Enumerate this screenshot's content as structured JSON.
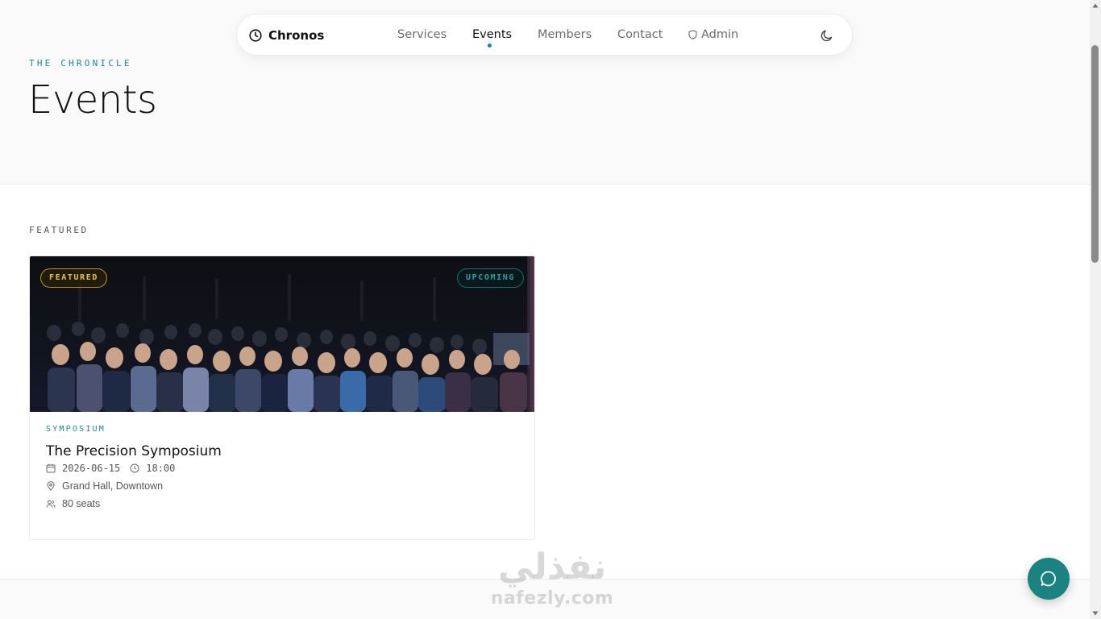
{
  "navbar": {
    "brand": "Chronos",
    "items": [
      {
        "label": "Services",
        "active": false
      },
      {
        "label": "Events",
        "active": true
      },
      {
        "label": "Members",
        "active": false
      },
      {
        "label": "Contact",
        "active": false
      }
    ],
    "admin_label": "Admin",
    "theme_icon": "moon-icon"
  },
  "hero": {
    "eyebrow": "THE CHRONICLE",
    "title": "Events"
  },
  "featured_section": {
    "label": "FEATURED",
    "card": {
      "badge_left": "FEATURED",
      "badge_right": "UPCOMING",
      "category": "SYMPOSIUM",
      "title": "The Precision Symposium",
      "date": "2026-06-15",
      "time": "18:00",
      "location": "Grand Hall, Downtown",
      "seats": "80 seats",
      "image_alt": "audience seated in a dark auditorium"
    }
  },
  "watermark": {
    "arabic": "نفذلي",
    "latin": "nafezly.com"
  },
  "chat_button": {
    "icon": "chat-bubble-icon"
  },
  "colors": {
    "accent": "#1a8a8a",
    "featured_badge": "#e6c44a",
    "fab": "#1a8280"
  }
}
